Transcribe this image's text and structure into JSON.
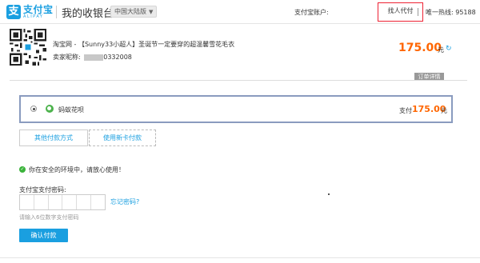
{
  "header": {
    "logo_cn": "支付宝",
    "logo_en": "ALIPAY",
    "cashier_title": "我的收银台",
    "region": "中国大陆版",
    "account_label": "支付宝账户:",
    "delegate_label": "找人代付",
    "hotline": "唯一热线: 95188"
  },
  "order": {
    "title": "淘宝网 - 【Sunny33小超人】圣诞节一定要穿的超温馨雪花毛衣",
    "seller_label": "卖家昵称:",
    "seller_suffix": "0332008",
    "price": "175.00",
    "currency_unit": "元",
    "detail_tab": "订单详情"
  },
  "payment": {
    "method_name": "蚂蚁花呗",
    "pay_label": "支付",
    "amount": "175.00",
    "unit": "元"
  },
  "options": {
    "other_methods": "其他付款方式",
    "new_card": "使用新卡付款"
  },
  "security": {
    "text": "你在安全的环境中，请放心使用！"
  },
  "password": {
    "label": "支付宝支付密码:",
    "forgot": "忘记密码?",
    "hint": "请输入6位数字支付密码",
    "confirm": "确认付款"
  },
  "colors": {
    "brand_blue": "#1a9fe0",
    "price_orange": "#ff6600",
    "highlight_red": "#ee2233"
  }
}
